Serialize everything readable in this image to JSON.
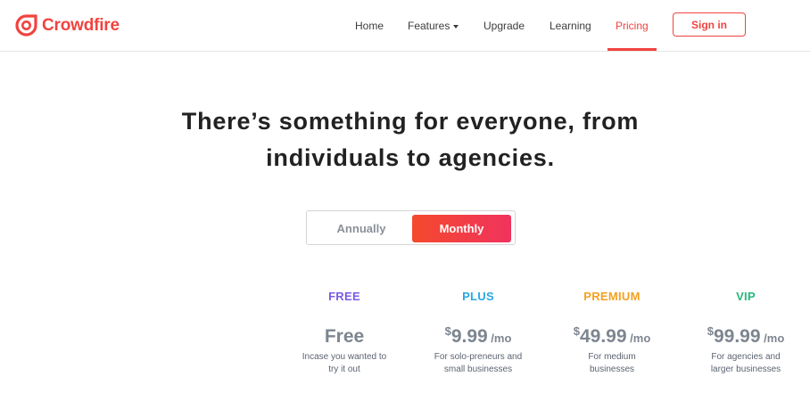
{
  "brand": {
    "name": "Crowdfire",
    "color": "#f1433f"
  },
  "nav": {
    "items": [
      {
        "label": "Home"
      },
      {
        "label": "Features"
      },
      {
        "label": "Upgrade"
      },
      {
        "label": "Learning"
      },
      {
        "label": "Pricing",
        "active": true
      }
    ],
    "signin_label": "Sign in"
  },
  "hero": {
    "line1": "There’s something for everyone, from",
    "line2": "individuals to agencies."
  },
  "billing_toggle": {
    "annual_label": "Annually",
    "monthly_label": "Monthly",
    "selected": "Monthly"
  },
  "plans": [
    {
      "name": "FREE",
      "color": "#7b5ce0",
      "price": "Free",
      "desc1": "Incase you wanted to",
      "desc2": "try it out"
    },
    {
      "name": "PLUS",
      "color": "#2aa8e0",
      "currency": "$",
      "price": "9.99",
      "period": " /mo",
      "desc1": "For solo-preneurs and",
      "desc2": "small businesses"
    },
    {
      "name": "PREMIUM",
      "color": "#f5a020",
      "currency": "$",
      "price": "49.99",
      "period": " /mo",
      "desc1": "For medium",
      "desc2": "businesses"
    },
    {
      "name": "VIP",
      "color": "#26b87a",
      "currency": "$",
      "price": "99.99",
      "period": " /mo",
      "desc1": "For agencies and",
      "desc2": "larger businesses"
    }
  ]
}
